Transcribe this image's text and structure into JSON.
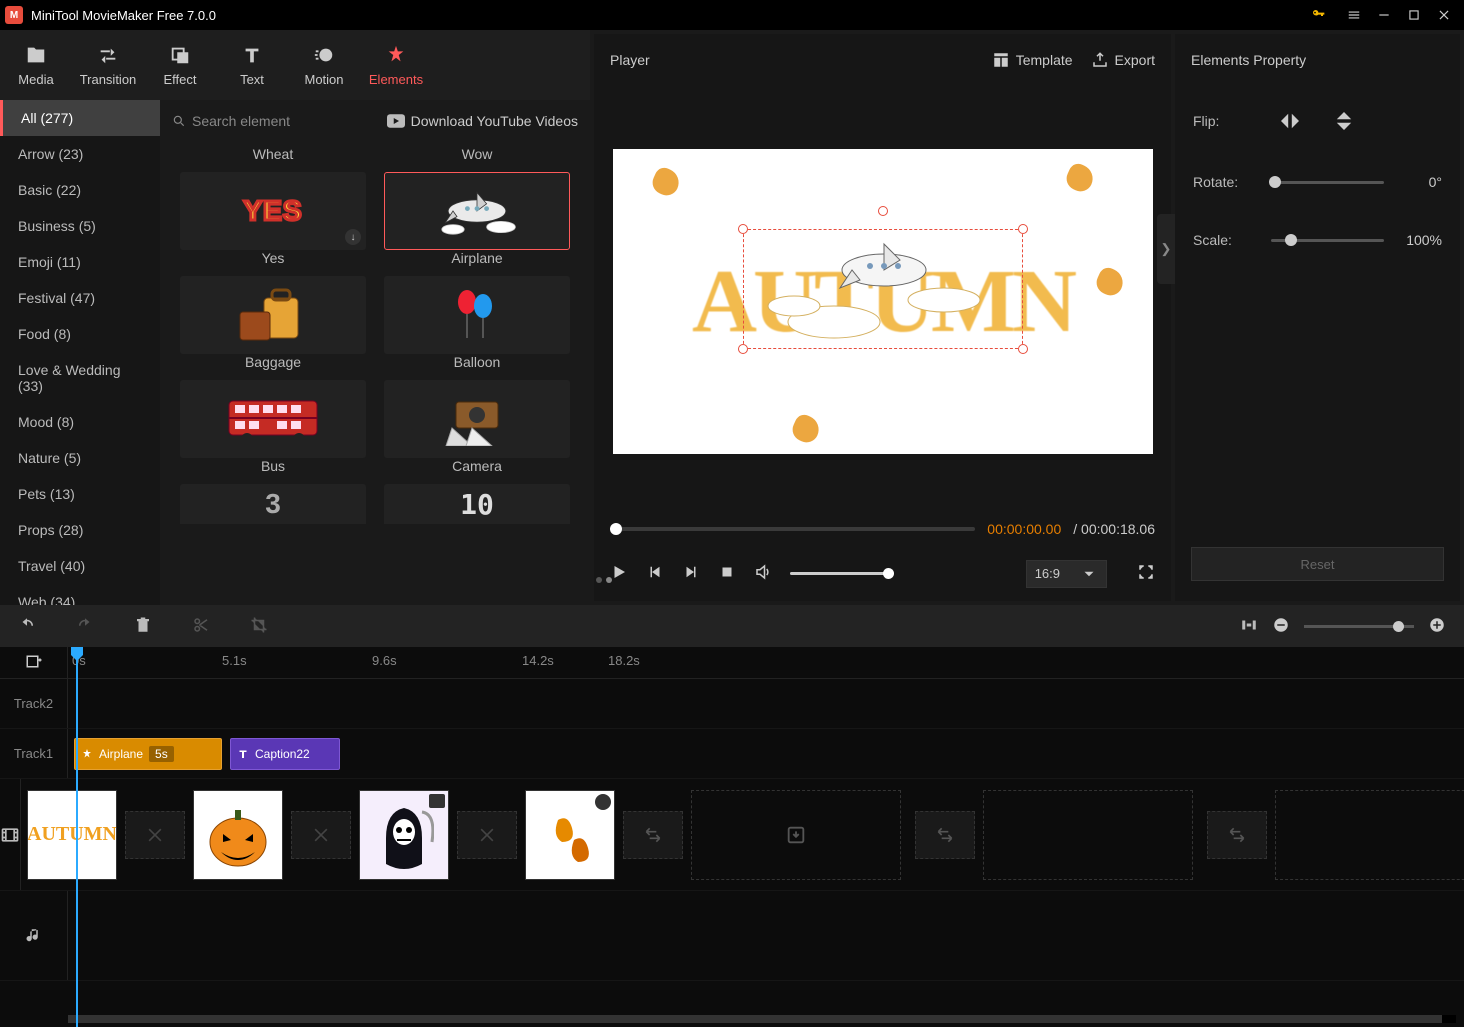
{
  "title": "MiniTool MovieMaker Free 7.0.0",
  "tabs": {
    "media": "Media",
    "transition": "Transition",
    "effect": "Effect",
    "text": "Text",
    "motion": "Motion",
    "elements": "Elements"
  },
  "active_tab": "elements",
  "categories": [
    {
      "label": "All (277)",
      "active": true
    },
    {
      "label": "Arrow (23)"
    },
    {
      "label": "Basic (22)"
    },
    {
      "label": "Business (5)"
    },
    {
      "label": "Emoji (11)"
    },
    {
      "label": "Festival (47)"
    },
    {
      "label": "Food (8)"
    },
    {
      "label": "Love & Wedding (33)"
    },
    {
      "label": "Mood (8)"
    },
    {
      "label": "Nature (5)"
    },
    {
      "label": "Pets (13)"
    },
    {
      "label": "Props (28)"
    },
    {
      "label": "Travel (40)"
    },
    {
      "label": "Web (34)"
    }
  ],
  "search_placeholder": "Search element",
  "yt_link": "Download YouTube Videos",
  "elements_top_row": {
    "left": "Wheat",
    "right": "Wow"
  },
  "elements": [
    {
      "name": "Yes"
    },
    {
      "name": "Airplane",
      "selected": true
    },
    {
      "name": "Baggage"
    },
    {
      "name": "Balloon"
    },
    {
      "name": "Bus"
    },
    {
      "name": "Camera"
    }
  ],
  "player": {
    "title": "Player",
    "template": "Template",
    "export": "Export",
    "time_current": "00:00:00.00",
    "time_total": "/ 00:00:18.06",
    "aspect": "16:9",
    "canvas_text": "AUTUMN"
  },
  "props": {
    "title": "Elements Property",
    "flip": "Flip:",
    "rotate": "Rotate:",
    "rotate_val": "0°",
    "scale": "Scale:",
    "scale_val": "100%",
    "reset": "Reset"
  },
  "timeline": {
    "ticks": [
      "0s",
      "5.1s",
      "9.6s",
      "14.2s",
      "18.2s"
    ],
    "track2": "Track2",
    "track1": "Track1",
    "clip_airplane": "Airplane",
    "clip_airplane_dur": "5s",
    "clip_caption": "Caption22"
  }
}
